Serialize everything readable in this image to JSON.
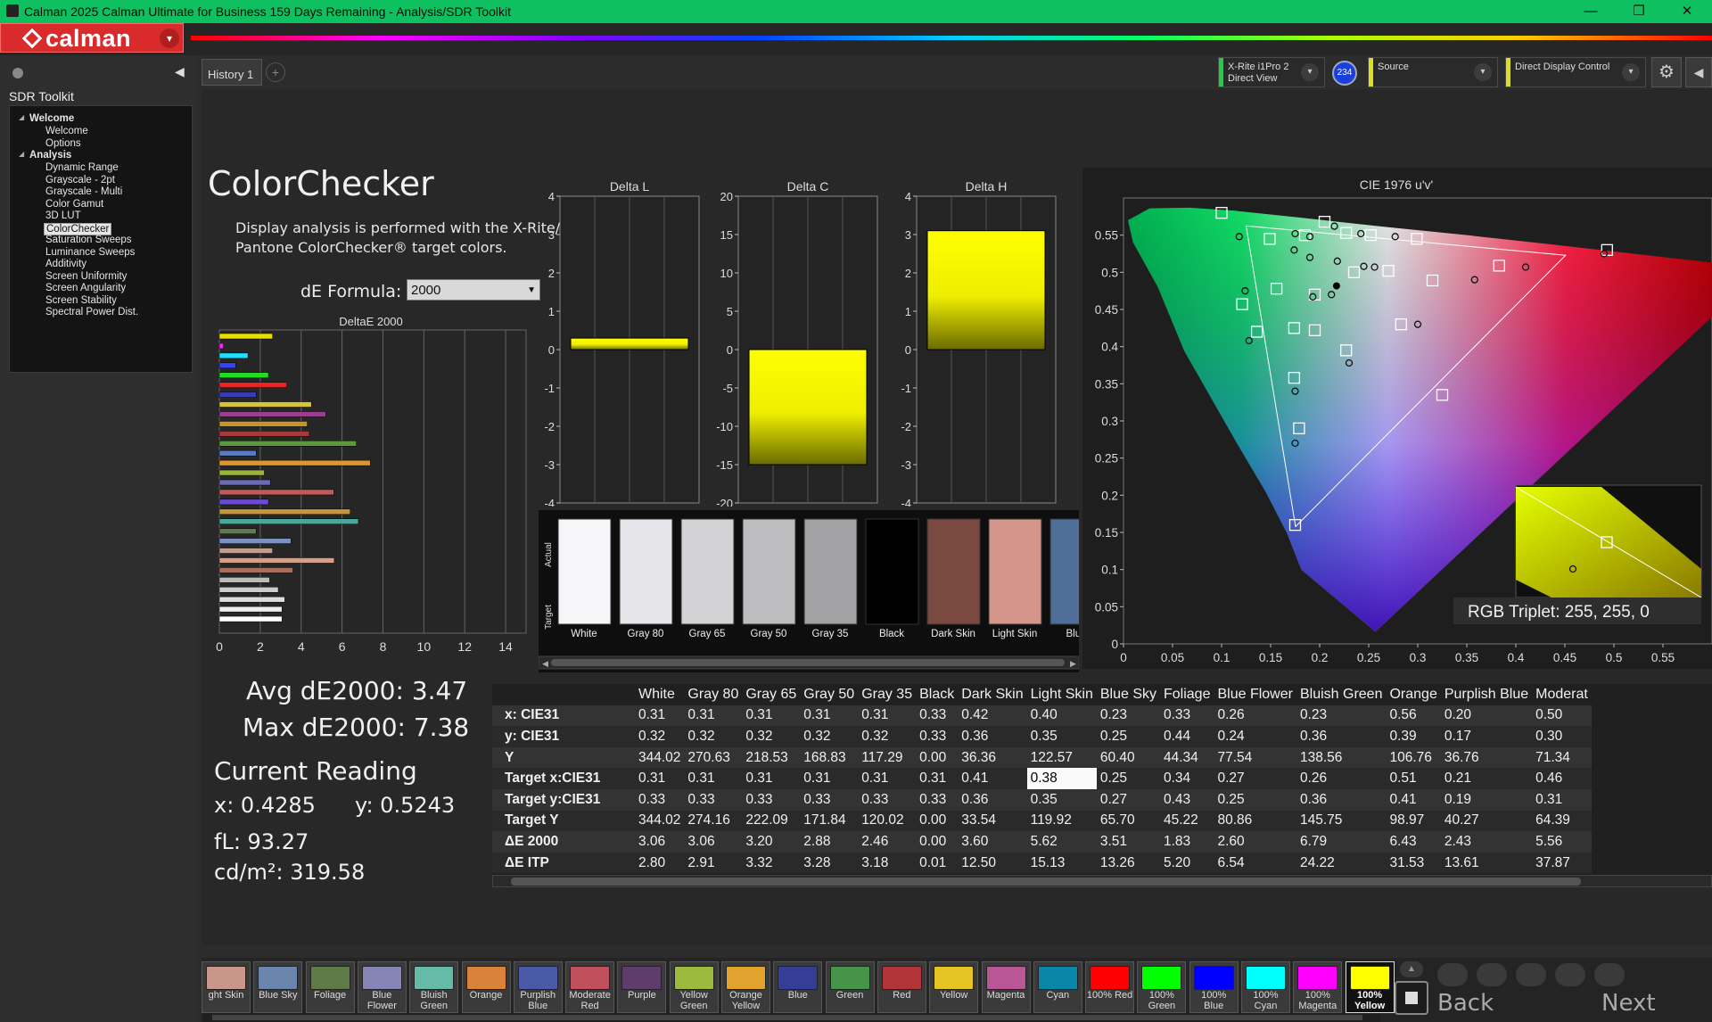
{
  "window": {
    "title": "Calman 2025 Calman Ultimate for Business 159 Days Remaining  - Analysis/SDR Toolkit",
    "minimize": "—",
    "maximize": "❐",
    "close": "✕"
  },
  "brand": {
    "name": "calman",
    "dropdown": "▾"
  },
  "sidebar": {
    "title": "SDR Toolkit",
    "groups": [
      {
        "label": "Welcome",
        "items": [
          "Welcome",
          "Options"
        ]
      },
      {
        "label": "Analysis",
        "items": [
          "Dynamic Range",
          "Grayscale - 2pt",
          "Grayscale - Multi",
          "Color Gamut",
          "3D LUT",
          "ColorChecker",
          "Saturation Sweeps",
          "Luminance Sweeps",
          "Additivity",
          "Screen Uniformity",
          "Screen Angularity",
          "Screen Stability",
          "Spectral Power Dist."
        ]
      }
    ],
    "selected": "ColorChecker"
  },
  "tabs": {
    "history": "History 1",
    "add": "+"
  },
  "devices": {
    "meter": {
      "line1": "X-Rite i1Pro 2",
      "line2": "Direct View",
      "color": "#22cc44"
    },
    "meter_badge": "234",
    "source": {
      "line1": "Source",
      "line2": "",
      "color": "#dddd22"
    },
    "display": {
      "line1": "Direct Display Control",
      "line2": "",
      "color": "#dddd22"
    },
    "dropdown": "▾"
  },
  "page": {
    "title": "ColorChecker",
    "desc1": "Display analysis is performed with the X-Rite/",
    "desc2": "Pantone ColorChecker® target colors.",
    "formula_label": "dE Formula:",
    "formula_value": "2000"
  },
  "stats": {
    "avg": "Avg dE2000: 3.47",
    "max": "Max dE2000: 7.38",
    "current_title": "Current Reading",
    "x": "x: 0.4285",
    "y": "y: 0.5243",
    "fl": "fL: 93.27",
    "cdm2": "cd/m²: 319.58"
  },
  "chart_data": [
    {
      "type": "bar",
      "title": "DeltaE 2000",
      "orientation": "horizontal",
      "xlim": [
        0,
        15
      ],
      "xticks": [
        "0",
        "2",
        "4",
        "6",
        "8",
        "10",
        "12",
        "14"
      ],
      "bars": [
        {
          "value": 2.6,
          "color": "#e8e000"
        },
        {
          "value": 0.2,
          "color": "#ff22ff"
        },
        {
          "value": 1.4,
          "color": "#22ddff"
        },
        {
          "value": 0.8,
          "color": "#3344ff"
        },
        {
          "value": 2.4,
          "color": "#22dd22"
        },
        {
          "value": 3.3,
          "color": "#ee2222"
        },
        {
          "value": 1.8,
          "color": "#3b3bb0"
        },
        {
          "value": 4.5,
          "color": "#d8c23a"
        },
        {
          "value": 5.2,
          "color": "#9b3e8e"
        },
        {
          "value": 4.3,
          "color": "#c4962a"
        },
        {
          "value": 4.4,
          "color": "#a43a3a"
        },
        {
          "value": 6.7,
          "color": "#5a9a3a"
        },
        {
          "value": 1.8,
          "color": "#5a7bc2"
        },
        {
          "value": 7.38,
          "color": "#e0952a"
        },
        {
          "value": 2.2,
          "color": "#9bb33a"
        },
        {
          "value": 2.5,
          "color": "#6a6ab0"
        },
        {
          "value": 5.6,
          "color": "#c25a5a"
        },
        {
          "value": 2.4,
          "color": "#6a4bd2"
        },
        {
          "value": 6.4,
          "color": "#c4963a"
        },
        {
          "value": 6.8,
          "color": "#4aa89a"
        },
        {
          "value": 1.8,
          "color": "#607a50"
        },
        {
          "value": 3.5,
          "color": "#7a8fc2"
        },
        {
          "value": 2.6,
          "color": "#c49a8a"
        },
        {
          "value": 5.62,
          "color": "#d2a08a"
        },
        {
          "value": 3.6,
          "color": "#b06a5a"
        },
        {
          "value": 2.46,
          "color": "#bbbbbb"
        },
        {
          "value": 2.88,
          "color": "#cccccc"
        },
        {
          "value": 3.2,
          "color": "#dddddd"
        },
        {
          "value": 3.06,
          "color": "#eeeeee"
        },
        {
          "value": 3.06,
          "color": "#ffffff"
        }
      ]
    },
    {
      "type": "bar",
      "title": "Delta L",
      "ylim": [
        -4,
        4
      ],
      "yticks": [
        "4",
        "3",
        "2",
        "1",
        "0",
        "-1",
        "-2",
        "-3",
        "-4"
      ],
      "values": [
        0.3
      ]
    },
    {
      "type": "bar",
      "title": "Delta C",
      "ylim": [
        -20,
        20
      ],
      "yticks": [
        "20",
        "15",
        "10",
        "5",
        "0",
        "-5",
        "-10",
        "-15",
        "-20"
      ],
      "values": [
        -15
      ]
    },
    {
      "type": "bar",
      "title": "Delta H",
      "ylim": [
        -4,
        4
      ],
      "yticks": [
        "4",
        "3",
        "2",
        "1",
        "0",
        "-1",
        "-2",
        "-3",
        "-4"
      ],
      "values": [
        3.1
      ]
    },
    {
      "type": "scatter",
      "title": "CIE 1976 u'v'",
      "xlim": [
        0,
        0.6
      ],
      "ylim": [
        0,
        0.6
      ],
      "xticks": [
        "0",
        "0.05",
        "0.1",
        "0.15",
        "0.2",
        "0.25",
        "0.3",
        "0.35",
        "0.4",
        "0.45",
        "0.5",
        "0.55"
      ],
      "yticks": [
        "0",
        "0.05",
        "0.1",
        "0.15",
        "0.2",
        "0.25",
        "0.3",
        "0.35",
        "0.4",
        "0.45",
        "0.5",
        "0.55"
      ],
      "gamut": [
        [
          0.4507,
          0.5229
        ],
        [
          0.125,
          0.5625
        ],
        [
          0.1754,
          0.1579
        ]
      ],
      "targets": [
        [
          0.1,
          0.58
        ],
        [
          0.205,
          0.568
        ],
        [
          0.227,
          0.553
        ],
        [
          0.252,
          0.55
        ],
        [
          0.299,
          0.545
        ],
        [
          0.149,
          0.545
        ],
        [
          0.185,
          0.55
        ],
        [
          0.493,
          0.53
        ],
        [
          0.383,
          0.509
        ],
        [
          0.315,
          0.489
        ],
        [
          0.27,
          0.502
        ],
        [
          0.235,
          0.5
        ],
        [
          0.156,
          0.478
        ],
        [
          0.121,
          0.457
        ],
        [
          0.195,
          0.47
        ],
        [
          0.283,
          0.43
        ],
        [
          0.174,
          0.425
        ],
        [
          0.195,
          0.422
        ],
        [
          0.136,
          0.42
        ],
        [
          0.227,
          0.395
        ],
        [
          0.174,
          0.358
        ],
        [
          0.325,
          0.335
        ],
        [
          0.179,
          0.29
        ],
        [
          0.175,
          0.16
        ]
      ],
      "measured": [
        [
          0.118,
          0.548
        ],
        [
          0.175,
          0.552
        ],
        [
          0.19,
          0.548
        ],
        [
          0.215,
          0.562
        ],
        [
          0.242,
          0.552
        ],
        [
          0.277,
          0.548
        ],
        [
          0.256,
          0.507
        ],
        [
          0.218,
          0.515
        ],
        [
          0.174,
          0.53
        ],
        [
          0.19,
          0.52
        ],
        [
          0.212,
          0.47
        ],
        [
          0.193,
          0.467
        ],
        [
          0.41,
          0.507
        ],
        [
          0.358,
          0.49
        ],
        [
          0.124,
          0.475
        ],
        [
          0.128,
          0.408
        ],
        [
          0.3,
          0.43
        ],
        [
          0.23,
          0.378
        ],
        [
          0.175,
          0.34
        ],
        [
          0.175,
          0.27
        ],
        [
          0.245,
          0.508
        ],
        [
          0.49,
          0.525
        ]
      ],
      "current": [
        0.2045,
        0.4745
      ],
      "inset_label": "RGB Triplet: 255, 255, 0"
    }
  ],
  "swatches": {
    "side_labels": [
      "Actual",
      "Target"
    ],
    "items": [
      {
        "label": "White",
        "color": "#f6f6f8"
      },
      {
        "label": "Gray 80",
        "color": "#e6e6ea"
      },
      {
        "label": "Gray 65",
        "color": "#d3d3d6"
      },
      {
        "label": "Gray 50",
        "color": "#bdbdbf"
      },
      {
        "label": "Gray 35",
        "color": "#a2a2a4"
      },
      {
        "label": "Black",
        "color": "#000000"
      },
      {
        "label": "Dark Skin",
        "color": "#7a4a40"
      },
      {
        "label": "Light Skin",
        "color": "#d4968a"
      },
      {
        "label": "Blue",
        "color": "#4f6f98"
      }
    ]
  },
  "table": {
    "columns": [
      "",
      "White",
      "Gray 80",
      "Gray 65",
      "Gray 50",
      "Gray 35",
      "Black",
      "Dark Skin",
      "Light Skin",
      "Blue Sky",
      "Foliage",
      "Blue Flower",
      "Bluish Green",
      "Orange",
      "Purplish Blue",
      "Moderat"
    ],
    "rows": [
      {
        "label": "x: CIE31",
        "cells": [
          "0.31",
          "0.31",
          "0.31",
          "0.31",
          "0.31",
          "0.33",
          "0.42",
          "0.40",
          "0.23",
          "0.33",
          "0.26",
          "0.23",
          "0.56",
          "0.20",
          "0.50"
        ]
      },
      {
        "label": "y: CIE31",
        "cells": [
          "0.32",
          "0.32",
          "0.32",
          "0.32",
          "0.32",
          "0.33",
          "0.36",
          "0.35",
          "0.25",
          "0.44",
          "0.24",
          "0.36",
          "0.39",
          "0.17",
          "0.30"
        ]
      },
      {
        "label": "Y",
        "cells": [
          "344.02",
          "270.63",
          "218.53",
          "168.83",
          "117.29",
          "0.00",
          "36.36",
          "122.57",
          "60.40",
          "44.34",
          "77.54",
          "138.56",
          "106.76",
          "36.76",
          "71.34"
        ]
      },
      {
        "label": "Target x:CIE31",
        "cells": [
          "0.31",
          "0.31",
          "0.31",
          "0.31",
          "0.31",
          "0.31",
          "0.41",
          "0.38",
          "0.25",
          "0.34",
          "0.27",
          "0.26",
          "0.51",
          "0.21",
          "0.46"
        ]
      },
      {
        "label": "Target y:CIE31",
        "cells": [
          "0.33",
          "0.33",
          "0.33",
          "0.33",
          "0.33",
          "0.33",
          "0.36",
          "0.35",
          "0.27",
          "0.43",
          "0.25",
          "0.36",
          "0.41",
          "0.19",
          "0.31"
        ]
      },
      {
        "label": "Target Y",
        "cells": [
          "344.02",
          "274.16",
          "222.09",
          "171.84",
          "120.02",
          "0.00",
          "33.54",
          "119.92",
          "65.70",
          "45.22",
          "80.86",
          "145.75",
          "98.97",
          "40.27",
          "64.39"
        ]
      },
      {
        "label": "ΔE 2000",
        "cells": [
          "3.06",
          "3.06",
          "3.20",
          "2.88",
          "2.46",
          "0.00",
          "3.60",
          "5.62",
          "3.51",
          "1.83",
          "2.60",
          "6.79",
          "6.43",
          "2.43",
          "5.56"
        ]
      },
      {
        "label": "ΔE ITP",
        "cells": [
          "2.80",
          "2.91",
          "3.32",
          "3.28",
          "3.18",
          "0.01",
          "12.50",
          "15.13",
          "13.26",
          "5.20",
          "6.54",
          "24.22",
          "31.53",
          "13.61",
          "37.87"
        ]
      }
    ]
  },
  "patches": [
    {
      "label": "ght Skin",
      "color": "#c8968a"
    },
    {
      "label": "Blue Sky",
      "color": "#6a86ae"
    },
    {
      "label": "Foliage",
      "color": "#5e7a46"
    },
    {
      "label": "Blue\nFlower",
      "color": "#8585b6"
    },
    {
      "label": "Bluish\nGreen",
      "color": "#66bba8"
    },
    {
      "label": "Orange",
      "color": "#d9823a"
    },
    {
      "label": "Purplish\nBlue",
      "color": "#4a5aa6"
    },
    {
      "label": "Moderate\nRed",
      "color": "#c0505c"
    },
    {
      "label": "Purple",
      "color": "#5e3c6c"
    },
    {
      "label": "Yellow\nGreen",
      "color": "#9cba3e"
    },
    {
      "label": "Orange\nYellow",
      "color": "#e0a42e"
    },
    {
      "label": "Blue",
      "color": "#343e96"
    },
    {
      "label": "Green",
      "color": "#46944a"
    },
    {
      "label": "Red",
      "color": "#b03438"
    },
    {
      "label": "Yellow",
      "color": "#e6c424"
    },
    {
      "label": "Magenta",
      "color": "#b85696"
    },
    {
      "label": "Cyan",
      "color": "#0a86a8"
    },
    {
      "label": "100% Red",
      "color": "#ff0000"
    },
    {
      "label": "100%\nGreen",
      "color": "#00ff00"
    },
    {
      "label": "100%\nBlue",
      "color": "#0000ff"
    },
    {
      "label": "100%\nCyan",
      "color": "#00ffff"
    },
    {
      "label": "100%\nMagenta",
      "color": "#ff00ff"
    },
    {
      "label": "100%\nYellow",
      "color": "#ffff00"
    }
  ],
  "selected_patch": "100%\nYellow",
  "nav": {
    "back": "Back",
    "next": "Next",
    "up": "▲"
  }
}
